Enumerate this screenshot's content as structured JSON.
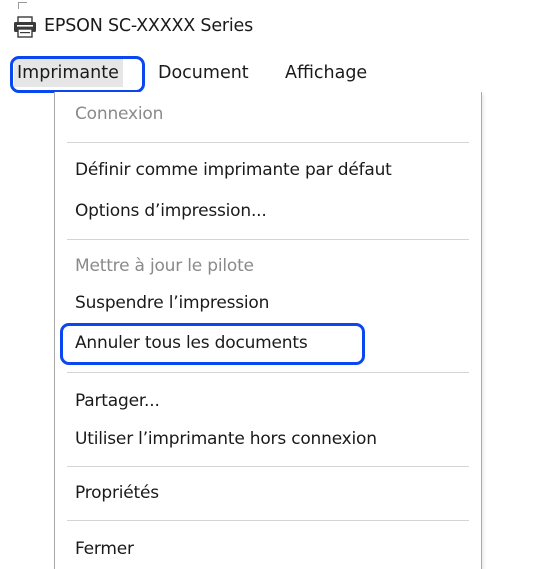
{
  "window": {
    "title": "EPSON SC-XXXXX Series",
    "icon": "printer-icon"
  },
  "menubar": {
    "items": [
      {
        "label": "Imprimante",
        "active": true
      },
      {
        "label": "Document",
        "active": false
      },
      {
        "label": "Affichage",
        "active": false
      }
    ]
  },
  "dropdown": {
    "items": [
      {
        "label": "Connexion",
        "enabled": false
      },
      {
        "label": "Définir comme imprimante par défaut",
        "enabled": true
      },
      {
        "label": "Options d’impression...",
        "enabled": true
      },
      {
        "label": "Mettre à jour le pilote",
        "enabled": false
      },
      {
        "label": "Suspendre l’impression",
        "enabled": true
      },
      {
        "label": "Annuler tous les documents",
        "enabled": true,
        "highlighted": true
      },
      {
        "label": "Partager...",
        "enabled": true
      },
      {
        "label": "Utiliser l’imprimante hors connexion",
        "enabled": true
      },
      {
        "label": "Propriétés",
        "enabled": true
      },
      {
        "label": "Fermer",
        "enabled": true
      }
    ]
  },
  "colors": {
    "highlight_outline": "#0b47f0",
    "disabled_text": "#8a8a8a",
    "active_menu_bg": "#e6e6e6"
  }
}
